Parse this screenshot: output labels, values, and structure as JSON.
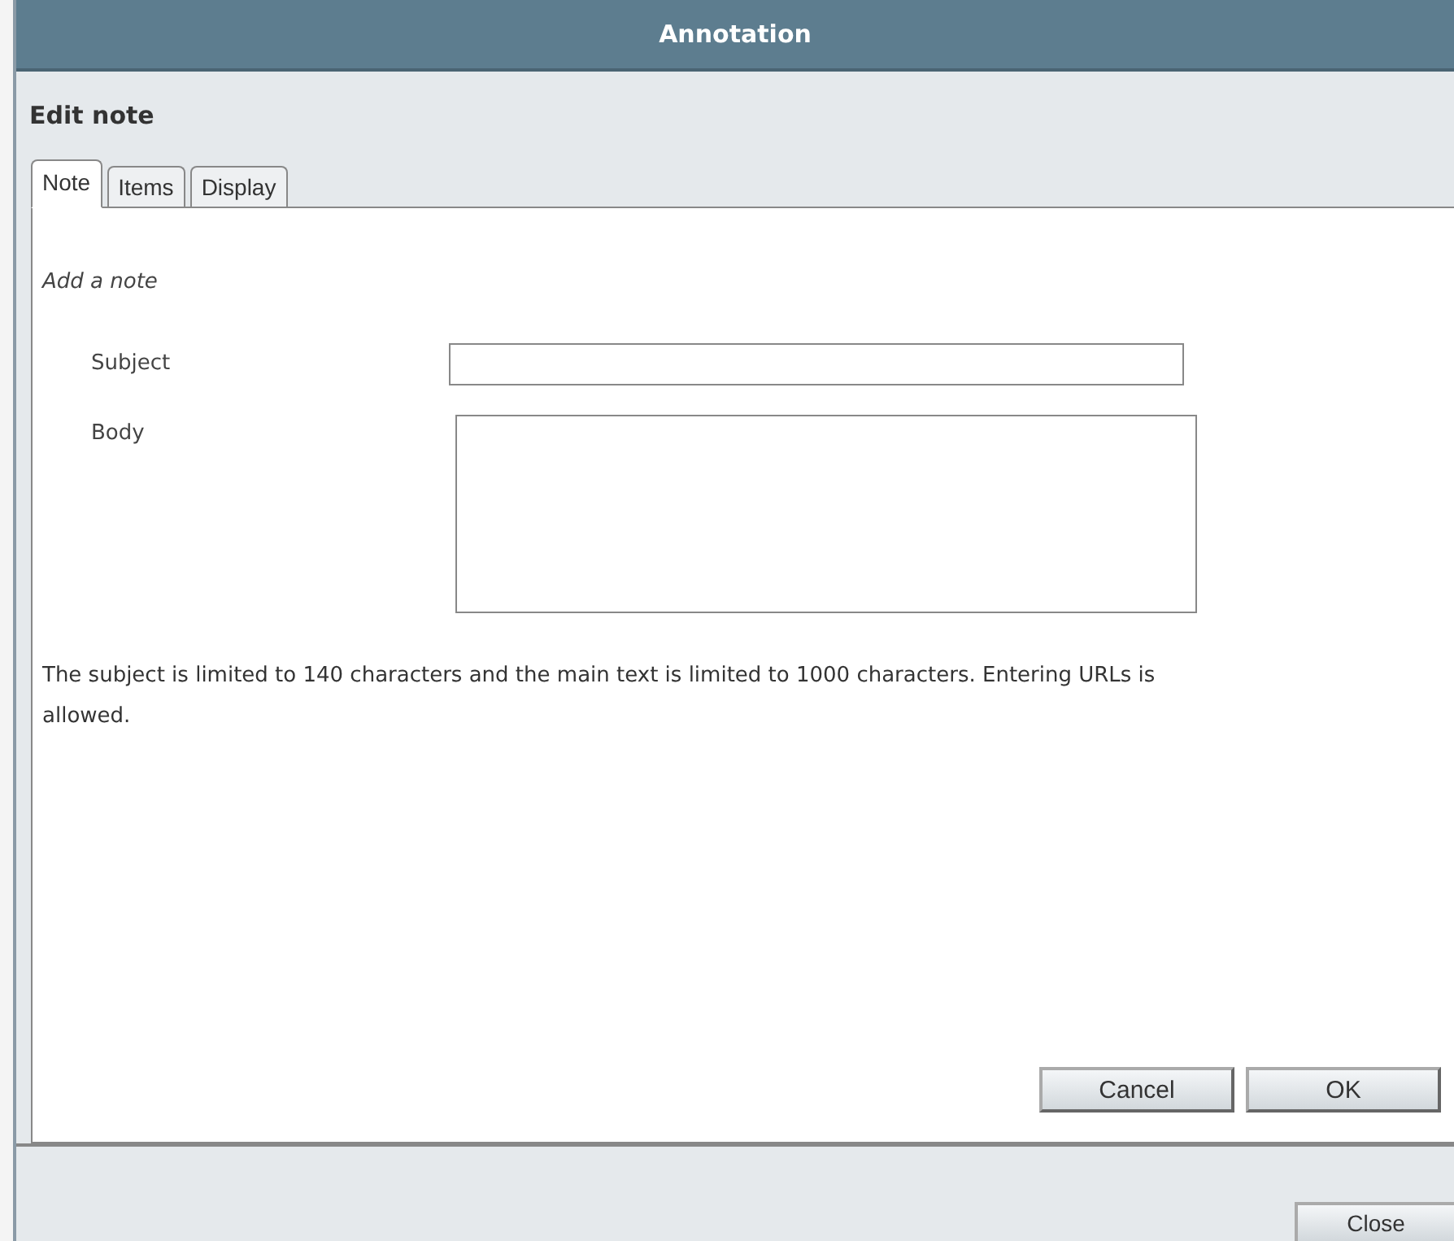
{
  "window": {
    "title": "Annotation"
  },
  "heading": "Edit note",
  "tabs": [
    {
      "label": "Note",
      "selected": true
    },
    {
      "label": "Items",
      "selected": false
    },
    {
      "label": "Display",
      "selected": false
    }
  ],
  "section_title": "Add a note",
  "fields": [
    {
      "label": "Subject",
      "kind": "input"
    },
    {
      "label": "Body",
      "kind": "textarea"
    }
  ],
  "info": "The subject is limited to 140 characters and the main text is limited to 1000 characters. Entering URLs is allowed.",
  "panel_buttons": [
    "Cancel",
    "OK"
  ],
  "footer_buttons": [
    "Close"
  ]
}
